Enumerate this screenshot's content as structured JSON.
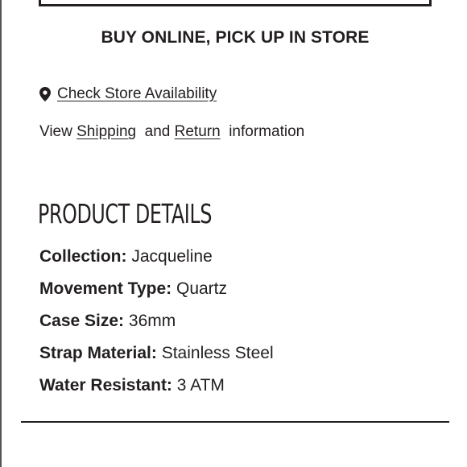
{
  "fulfillment": {
    "heading": "BUY ONLINE, PICK UP IN STORE",
    "store_link": "Check Store Availability",
    "store_icon": "map-pin-icon"
  },
  "policy": {
    "prefix": "View ",
    "shipping_link": "Shipping",
    "middle": "  and ",
    "return_link": "Return",
    "suffix": "  information"
  },
  "product_details": {
    "title": "PRODUCT DETAILS",
    "specs": [
      {
        "label": "Collection:",
        "value": "Jacqueline"
      },
      {
        "label": "Movement Type:",
        "value": "Quartz"
      },
      {
        "label": "Case Size:",
        "value": "36mm"
      },
      {
        "label": "Strap Material:",
        "value": "Stainless Steel"
      },
      {
        "label": "Water Resistant:",
        "value": "3 ATM"
      }
    ]
  },
  "colors": {
    "text": "#231f20"
  }
}
